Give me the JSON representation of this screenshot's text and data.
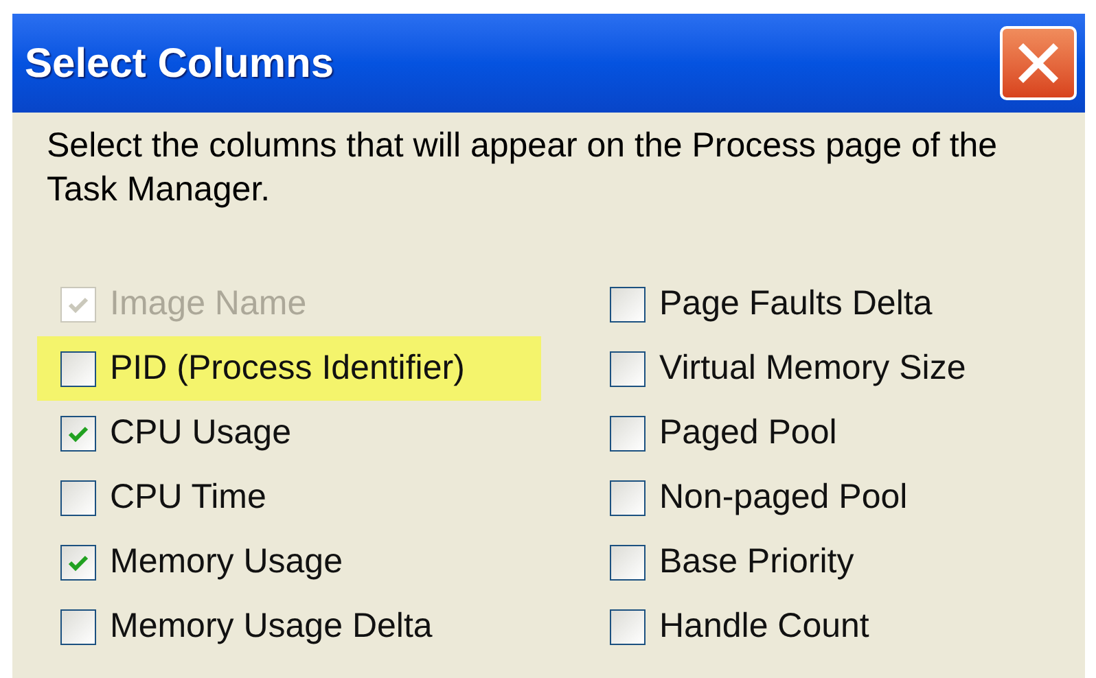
{
  "window": {
    "title": "Select Columns"
  },
  "instructions": "Select the columns that will appear on the Process page of the Task Manager.",
  "columns": [
    [
      {
        "label": "Image Name",
        "checked": true,
        "disabled": true,
        "highlighted": false
      },
      {
        "label": "PID (Process Identifier)",
        "checked": false,
        "disabled": false,
        "highlighted": true
      },
      {
        "label": "CPU Usage",
        "checked": true,
        "disabled": false,
        "highlighted": false
      },
      {
        "label": "CPU Time",
        "checked": false,
        "disabled": false,
        "highlighted": false
      },
      {
        "label": "Memory Usage",
        "checked": true,
        "disabled": false,
        "highlighted": false
      },
      {
        "label": "Memory Usage Delta",
        "checked": false,
        "disabled": false,
        "highlighted": false
      }
    ],
    [
      {
        "label": "Page Faults Delta",
        "checked": false,
        "disabled": false,
        "highlighted": false
      },
      {
        "label": "Virtual Memory Size",
        "checked": false,
        "disabled": false,
        "highlighted": false
      },
      {
        "label": "Paged Pool",
        "checked": false,
        "disabled": false,
        "highlighted": false
      },
      {
        "label": "Non-paged Pool",
        "checked": false,
        "disabled": false,
        "highlighted": false
      },
      {
        "label": "Base Priority",
        "checked": false,
        "disabled": false,
        "highlighted": false
      },
      {
        "label": "Handle Count",
        "checked": false,
        "disabled": false,
        "highlighted": false
      }
    ]
  ]
}
